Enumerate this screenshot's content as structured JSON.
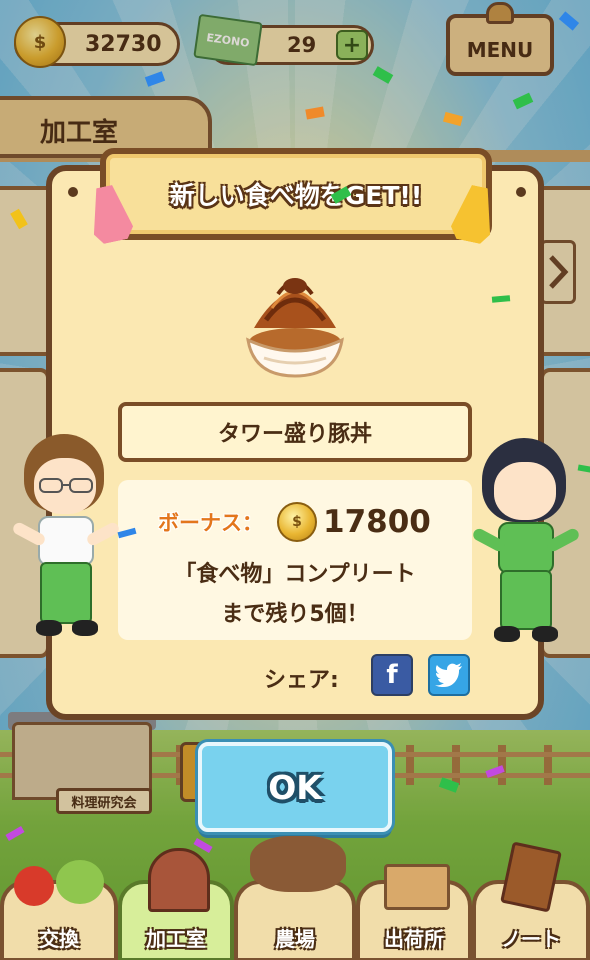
{
  "hud": {
    "coins": "32730",
    "ticket_label": "EZONO",
    "tickets": "29",
    "plus": "+",
    "menu": "MENU"
  },
  "room": {
    "title": "加工室"
  },
  "dialog": {
    "header": "新しい食べ物をGET!!",
    "food_name": "タワー盛り豚丼",
    "bonus_label": "ボーナス：",
    "bonus_value": "17800",
    "message_line1": "「食べ物」コンプリート",
    "message_line2": "まで残り5個！",
    "share_label": "シェア:",
    "facebook_glyph": "f",
    "twitter_glyph": "t"
  },
  "ok_label": "OK",
  "scene": {
    "building_sign": "料理研究会"
  },
  "nav": [
    {
      "label": "交換"
    },
    {
      "label": "加工室"
    },
    {
      "label": "農場"
    },
    {
      "label": "出荷所"
    },
    {
      "label": "ノート"
    }
  ],
  "colors": {
    "wood_border": "#6b4426",
    "panel": "#fbe8b2",
    "ok_button": "#79d2ee",
    "bonus_label": "#e3761c",
    "facebook": "#3a5ba3",
    "twitter": "#36a5e6"
  }
}
